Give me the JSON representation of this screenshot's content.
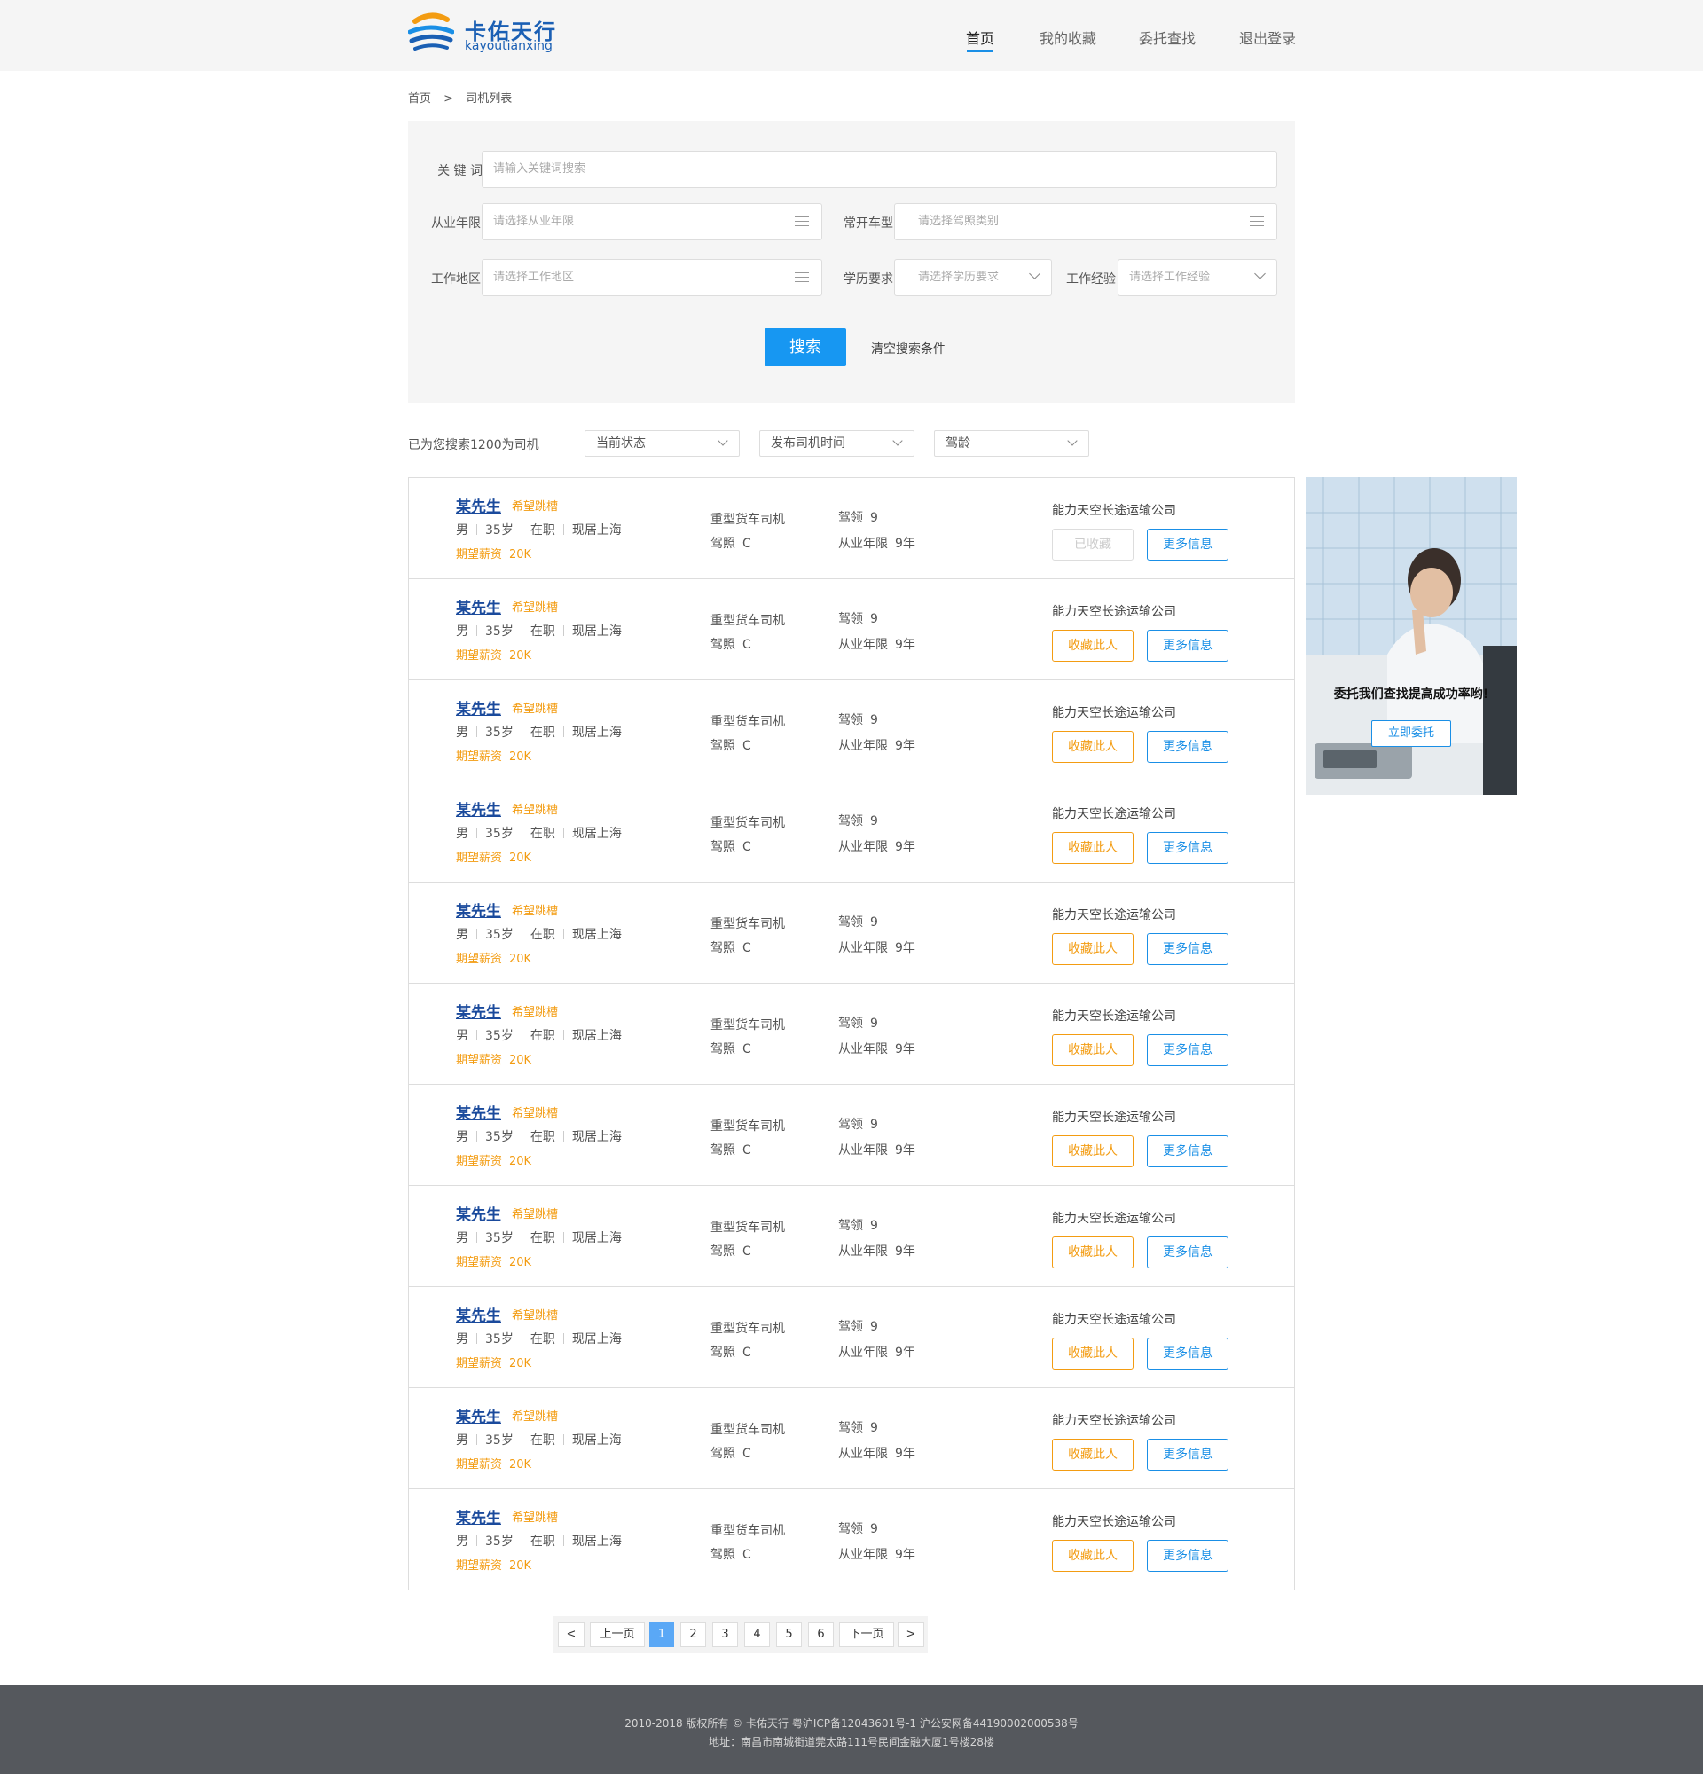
{
  "brand": {
    "name_cn": "卡佑天行",
    "name_en": "kayoutianxing",
    "color": "#1a5fb4"
  },
  "nav": {
    "items": [
      {
        "label": "首页",
        "active": true
      },
      {
        "label": "我的收藏"
      },
      {
        "label": "委托查找"
      },
      {
        "label": "退出登录"
      }
    ]
  },
  "breadcrumb": {
    "home": "首页",
    "sep": ">",
    "current": "司机列表"
  },
  "search": {
    "keyword_label": "关 键 词",
    "keyword_placeholder": "请输入关键词搜索",
    "years_label": "从业年限",
    "years_placeholder": "请选择从业年限",
    "vehicle_label": "常开车型",
    "vehicle_placeholder": "请选择驾照类别",
    "area_label": "工作地区",
    "area_placeholder": "请选择工作地区",
    "edu_label": "学历要求",
    "edu_placeholder": "请选择学历要求",
    "exp_label": "工作经验",
    "exp_placeholder": "请选择工作经验",
    "search_button": "搜索",
    "clear_button": "清空搜索条件"
  },
  "results": {
    "count_text": "已为您搜索1200为司机",
    "filters": [
      "当前状态",
      "发布司机时间",
      "驾龄"
    ]
  },
  "drivers": [
    {
      "name": "某先生",
      "tag": "希望跳槽",
      "gender": "男",
      "age": "35岁",
      "status": "在职",
      "location": "现居上海",
      "salary_label": "期望薪资",
      "salary": "20K",
      "job": "重型货车司机",
      "license_label": "驾照",
      "license": "C",
      "driving_age_label": "驾领",
      "driving_age": "9",
      "years_label": "从业年限",
      "years": "9年",
      "company": "能力天空长途运输公司",
      "collect": "已收藏",
      "collected": true,
      "more": "更多信息"
    },
    {
      "name": "某先生",
      "tag": "希望跳槽",
      "gender": "男",
      "age": "35岁",
      "status": "在职",
      "location": "现居上海",
      "salary_label": "期望薪资",
      "salary": "20K",
      "job": "重型货车司机",
      "license_label": "驾照",
      "license": "C",
      "driving_age_label": "驾领",
      "driving_age": "9",
      "years_label": "从业年限",
      "years": "9年",
      "company": "能力天空长途运输公司",
      "collect": "收藏此人",
      "collected": false,
      "more": "更多信息"
    },
    {
      "name": "某先生",
      "tag": "希望跳槽",
      "gender": "男",
      "age": "35岁",
      "status": "在职",
      "location": "现居上海",
      "salary_label": "期望薪资",
      "salary": "20K",
      "job": "重型货车司机",
      "license_label": "驾照",
      "license": "C",
      "driving_age_label": "驾领",
      "driving_age": "9",
      "years_label": "从业年限",
      "years": "9年",
      "company": "能力天空长途运输公司",
      "collect": "收藏此人",
      "collected": false,
      "more": "更多信息"
    },
    {
      "name": "某先生",
      "tag": "希望跳槽",
      "gender": "男",
      "age": "35岁",
      "status": "在职",
      "location": "现居上海",
      "salary_label": "期望薪资",
      "salary": "20K",
      "job": "重型货车司机",
      "license_label": "驾照",
      "license": "C",
      "driving_age_label": "驾领",
      "driving_age": "9",
      "years_label": "从业年限",
      "years": "9年",
      "company": "能力天空长途运输公司",
      "collect": "收藏此人",
      "collected": false,
      "more": "更多信息"
    },
    {
      "name": "某先生",
      "tag": "希望跳槽",
      "gender": "男",
      "age": "35岁",
      "status": "在职",
      "location": "现居上海",
      "salary_label": "期望薪资",
      "salary": "20K",
      "job": "重型货车司机",
      "license_label": "驾照",
      "license": "C",
      "driving_age_label": "驾领",
      "driving_age": "9",
      "years_label": "从业年限",
      "years": "9年",
      "company": "能力天空长途运输公司",
      "collect": "收藏此人",
      "collected": false,
      "more": "更多信息"
    },
    {
      "name": "某先生",
      "tag": "希望跳槽",
      "gender": "男",
      "age": "35岁",
      "status": "在职",
      "location": "现居上海",
      "salary_label": "期望薪资",
      "salary": "20K",
      "job": "重型货车司机",
      "license_label": "驾照",
      "license": "C",
      "driving_age_label": "驾领",
      "driving_age": "9",
      "years_label": "从业年限",
      "years": "9年",
      "company": "能力天空长途运输公司",
      "collect": "收藏此人",
      "collected": false,
      "more": "更多信息"
    },
    {
      "name": "某先生",
      "tag": "希望跳槽",
      "gender": "男",
      "age": "35岁",
      "status": "在职",
      "location": "现居上海",
      "salary_label": "期望薪资",
      "salary": "20K",
      "job": "重型货车司机",
      "license_label": "驾照",
      "license": "C",
      "driving_age_label": "驾领",
      "driving_age": "9",
      "years_label": "从业年限",
      "years": "9年",
      "company": "能力天空长途运输公司",
      "collect": "收藏此人",
      "collected": false,
      "more": "更多信息"
    },
    {
      "name": "某先生",
      "tag": "希望跳槽",
      "gender": "男",
      "age": "35岁",
      "status": "在职",
      "location": "现居上海",
      "salary_label": "期望薪资",
      "salary": "20K",
      "job": "重型货车司机",
      "license_label": "驾照",
      "license": "C",
      "driving_age_label": "驾领",
      "driving_age": "9",
      "years_label": "从业年限",
      "years": "9年",
      "company": "能力天空长途运输公司",
      "collect": "收藏此人",
      "collected": false,
      "more": "更多信息"
    },
    {
      "name": "某先生",
      "tag": "希望跳槽",
      "gender": "男",
      "age": "35岁",
      "status": "在职",
      "location": "现居上海",
      "salary_label": "期望薪资",
      "salary": "20K",
      "job": "重型货车司机",
      "license_label": "驾照",
      "license": "C",
      "driving_age_label": "驾领",
      "driving_age": "9",
      "years_label": "从业年限",
      "years": "9年",
      "company": "能力天空长途运输公司",
      "collect": "收藏此人",
      "collected": false,
      "more": "更多信息"
    },
    {
      "name": "某先生",
      "tag": "希望跳槽",
      "gender": "男",
      "age": "35岁",
      "status": "在职",
      "location": "现居上海",
      "salary_label": "期望薪资",
      "salary": "20K",
      "job": "重型货车司机",
      "license_label": "驾照",
      "license": "C",
      "driving_age_label": "驾领",
      "driving_age": "9",
      "years_label": "从业年限",
      "years": "9年",
      "company": "能力天空长途运输公司",
      "collect": "收藏此人",
      "collected": false,
      "more": "更多信息"
    },
    {
      "name": "某先生",
      "tag": "希望跳槽",
      "gender": "男",
      "age": "35岁",
      "status": "在职",
      "location": "现居上海",
      "salary_label": "期望薪资",
      "salary": "20K",
      "job": "重型货车司机",
      "license_label": "驾照",
      "license": "C",
      "driving_age_label": "驾领",
      "driving_age": "9",
      "years_label": "从业年限",
      "years": "9年",
      "company": "能力天空长途运输公司",
      "collect": "收藏此人",
      "collected": false,
      "more": "更多信息"
    }
  ],
  "ad": {
    "text": "委托我们查找提高成功率哟!",
    "button": "立即委托"
  },
  "pagination": {
    "first": "<",
    "prev": "上一页",
    "pages": [
      "1",
      "2",
      "3",
      "4",
      "5",
      "6"
    ],
    "current": "1",
    "next": "下一页",
    "last": ">"
  },
  "footer": {
    "line1": "2010-2018 版权所有 © 卡佑天行 粤沪ICP备12043601号-1 沪公安网备44190002000538号",
    "line2": "地址：南昌市南城街道莞太路111号民间金融大厦1号楼28楼"
  },
  "colors": {
    "primary": "#1797f2",
    "accent": "#f39c12",
    "footer_bg": "#55585d"
  }
}
